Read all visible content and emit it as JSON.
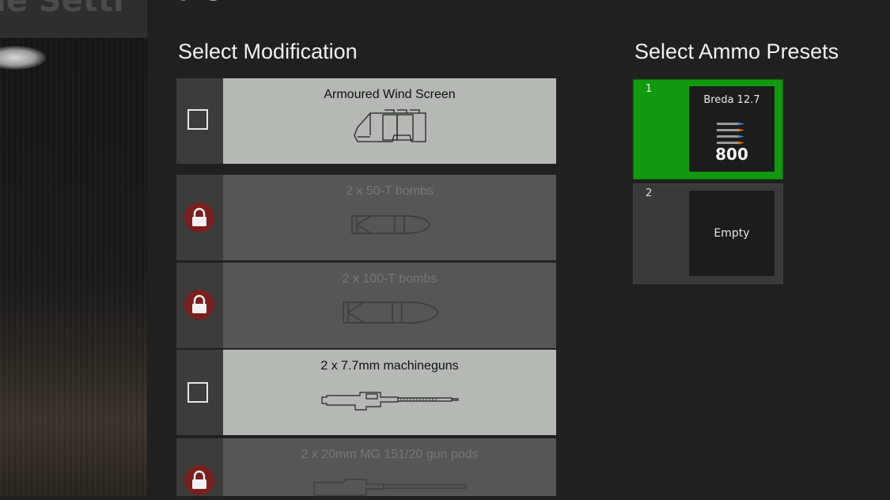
{
  "background": {
    "title_fragment": "le Setti"
  },
  "panel": {
    "title_fragment": "p          g"
  },
  "modifications": {
    "title": "Select Modification",
    "items": [
      {
        "label": "Armoured Wind Screen",
        "state": "available",
        "checked": false,
        "icon": "windscreen-icon"
      },
      {
        "label": "2 x 50-T bombs",
        "state": "locked",
        "icon": "bomb-icon"
      },
      {
        "label": "2 x 100-T bombs",
        "state": "locked",
        "icon": "bomb-icon"
      },
      {
        "label": "2 x 7.7mm machineguns",
        "state": "available",
        "checked": false,
        "icon": "machinegun-icon"
      },
      {
        "label": "2 x 20mm MG 151/20 gun pods",
        "state": "locked",
        "icon": "gun-pod-icon"
      }
    ]
  },
  "ammo_presets": {
    "title": "Select Ammo Presets",
    "items": [
      {
        "number": "1",
        "name": "Breda 12.7",
        "count": "800",
        "selected": true,
        "icon": "ammo-belt-icon"
      },
      {
        "number": "2",
        "empty_label": "Empty",
        "selected": false
      }
    ]
  },
  "colors": {
    "selected_green": "#11990f",
    "lock_red": "#7a1f1f",
    "available_row": "#b5b9b4",
    "locked_row": "#555755"
  }
}
